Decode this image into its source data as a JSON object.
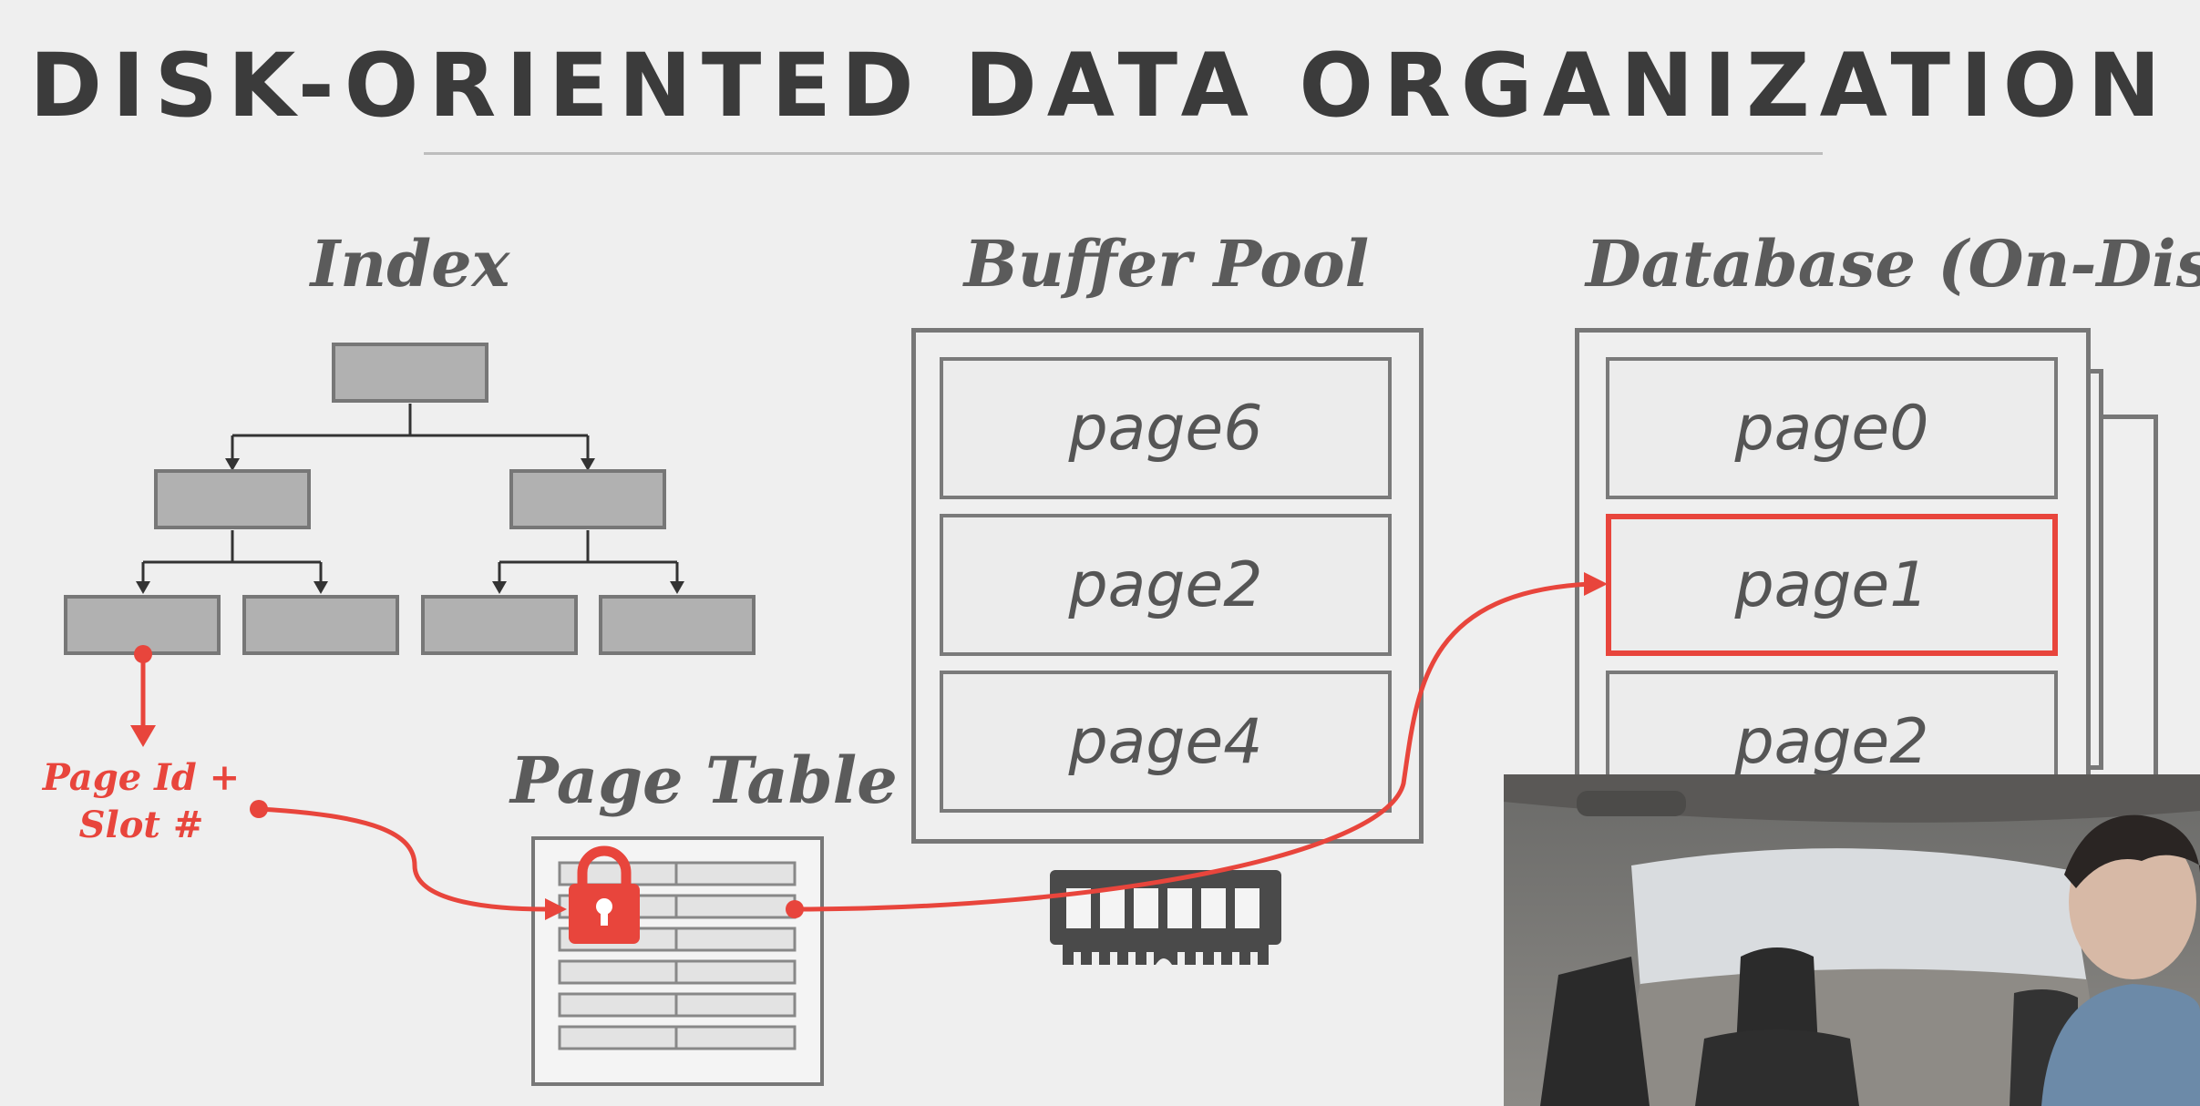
{
  "slide": {
    "title": "DISK-ORIENTED DATA ORGANIZATION"
  },
  "index": {
    "heading": "Index",
    "pointer_label_line1": "Page Id +",
    "pointer_label_line2": "Slot #"
  },
  "page_table": {
    "heading": "Page Table",
    "row_count": 6,
    "locked_row": 1
  },
  "buffer_pool": {
    "heading": "Buffer Pool",
    "pages": [
      "page6",
      "page2",
      "page4"
    ]
  },
  "database": {
    "heading": "Database (On-Disk)",
    "pages": [
      "page0",
      "page1",
      "page2"
    ],
    "highlighted_page": "page1"
  },
  "colors": {
    "accent": "#e8453c",
    "text": "#3b3b3b",
    "node_fill": "#b1b1b1"
  }
}
